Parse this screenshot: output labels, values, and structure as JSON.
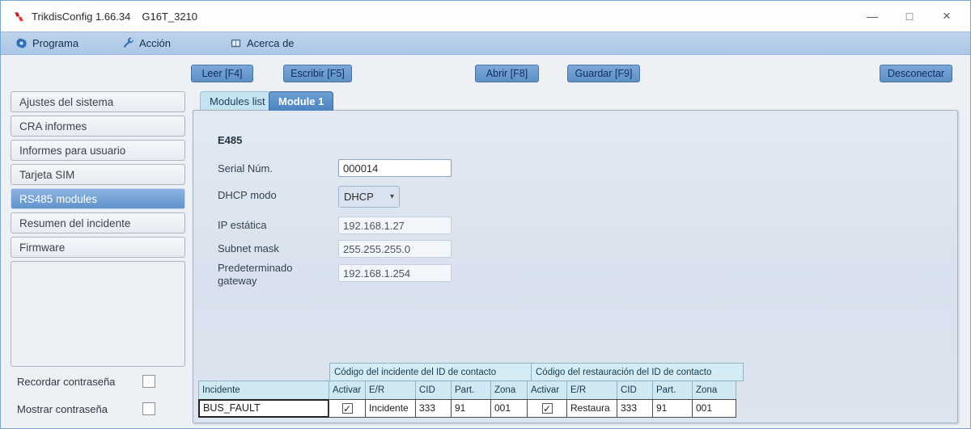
{
  "window": {
    "title": "TrikdisConfig 1.66.34",
    "device": "G16T_3210",
    "controls": {
      "minimize": "—",
      "maximize": "□",
      "close": "×"
    }
  },
  "menubar": {
    "items": [
      {
        "label": "Programa",
        "icon": "gear-icon"
      },
      {
        "label": "Acción",
        "icon": "wrench-icon"
      },
      {
        "label": "Acerca de",
        "icon": "book-icon"
      }
    ]
  },
  "toolbar": {
    "read": "Leer [F4]",
    "write": "Escribir [F5]",
    "open": "Abrir [F8]",
    "save": "Guardar [F9]",
    "disconnect": "Desconectar"
  },
  "sidebar": {
    "items": [
      "Ajustes del sistema",
      "CRA informes",
      "Informes para usuario",
      "Tarjeta SIM",
      "RS485 modules",
      "Resumen del incidente",
      "Firmware"
    ],
    "selected": "RS485 modules",
    "remember_password_label": "Recordar contraseña",
    "show_password_label": "Mostrar contraseña",
    "remember_password_checked": false,
    "show_password_checked": false
  },
  "tabs": [
    {
      "label": "Modules list",
      "active": false
    },
    {
      "label": "Module 1",
      "active": true
    }
  ],
  "form": {
    "heading": "E485",
    "fields": [
      {
        "label": "Serial Núm.",
        "value": "000014",
        "type": "text",
        "enabled": true
      },
      {
        "label": "DHCP modo",
        "value": "DHCP",
        "type": "select",
        "enabled": true
      },
      {
        "label": "IP estática",
        "value": "192.168.1.27",
        "type": "text",
        "enabled": false
      },
      {
        "label": "Subnet mask",
        "value": "255.255.255.0",
        "type": "text",
        "enabled": false
      },
      {
        "label": "Predeterminado gateway",
        "value": "192.168.1.254",
        "type": "text",
        "enabled": false
      }
    ]
  },
  "table": {
    "group_headers": [
      "Código del incidente del ID de contacto",
      "Código del restauración del ID de contacto"
    ],
    "columns": [
      "Incidente",
      "Activar",
      "E/R",
      "CID",
      "Part.",
      "Zona",
      "Activar",
      "E/R",
      "CID",
      "Part.",
      "Zona"
    ],
    "rows": [
      {
        "incidente": "BUS_FAULT",
        "event": {
          "activar": true,
          "er": "Incidente",
          "cid": "333",
          "part": "91",
          "zona": "001"
        },
        "restore": {
          "activar": true,
          "er": "Restaura",
          "cid": "333",
          "part": "91",
          "zona": "001"
        }
      }
    ]
  },
  "icons": {
    "check": "✓",
    "dropdown_arrow": "▾"
  },
  "colors": {
    "accent": "#5d8fc6",
    "menubar": "#abc8e6",
    "table_header": "#cfe8f2",
    "selected_item": "#6093cc"
  }
}
